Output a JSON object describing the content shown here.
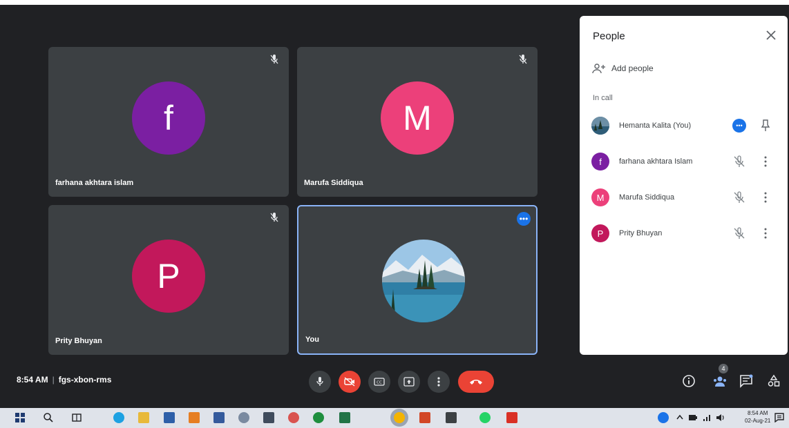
{
  "tiles": [
    {
      "name": "farhana akhtara islam",
      "initial": "f",
      "color": "#7b1fa2"
    },
    {
      "name": "Marufa Siddiqua",
      "initial": "M",
      "color": "#ec407a"
    },
    {
      "name": "Prity Bhuyan",
      "initial": "P",
      "color": "#c2185b"
    },
    {
      "name": "You"
    }
  ],
  "panel": {
    "title": "People",
    "add_people": "Add people",
    "section": "In call",
    "participants": [
      {
        "name": "Hemanta Kalita (You)",
        "initial": "",
        "color": "#4a6572"
      },
      {
        "name": "farhana akhtara Islam",
        "initial": "f",
        "color": "#7b1fa2"
      },
      {
        "name": "Marufa Siddiqua",
        "initial": "M",
        "color": "#ec407a"
      },
      {
        "name": "Prity Bhuyan",
        "initial": "P",
        "color": "#c2185b"
      }
    ]
  },
  "meeting": {
    "time": "8:54 AM",
    "separator": "|",
    "code": "fgs-xbon-rms"
  },
  "participants_count": "4",
  "taskbar": {
    "time": "8:54 AM",
    "date": "02-Aug-21"
  },
  "colors": {
    "background": "#202124",
    "tile": "#3c4043",
    "accent": "#1a73e8",
    "danger": "#ea4335"
  }
}
